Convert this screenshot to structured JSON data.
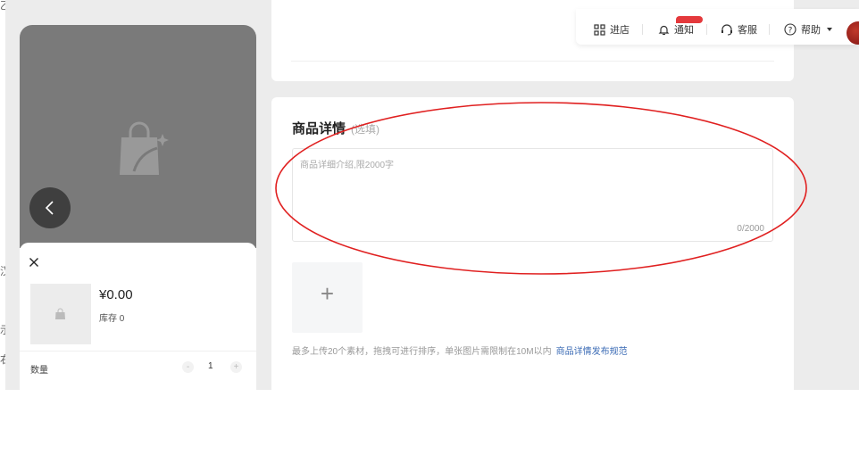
{
  "header": {
    "store_label": "进店",
    "notice_label": "通知",
    "service_label": "客服",
    "help_label": "帮助"
  },
  "edge_stubs": [
    "乙",
    "汉",
    "示",
    "右"
  ],
  "detail": {
    "title": "商品详情",
    "optional": "(选填)",
    "placeholder": "商品详细介绍,限2000字",
    "counter": "0/2000",
    "upload_plus": "+",
    "upload_tip": "最多上传20个素材，拖拽可进行排序，单张图片需限制在10M以内",
    "rules_link": "商品详情发布规范"
  },
  "preview": {
    "price": "¥0.00",
    "stock": "库存 0",
    "quantity_label": "数量",
    "minus": "-",
    "quantity": "1",
    "plus": "+"
  },
  "colors": {
    "page_bg": "#ececec",
    "accent_red": "#e4393c",
    "link_blue": "#3b6bb5",
    "annotation": "#e02020"
  },
  "icons": [
    "store-icon",
    "bell-icon",
    "headset-icon",
    "help-icon",
    "chevron-down-icon",
    "shopping-bag-icon",
    "back-arrow-icon",
    "close-icon",
    "avatar"
  ]
}
